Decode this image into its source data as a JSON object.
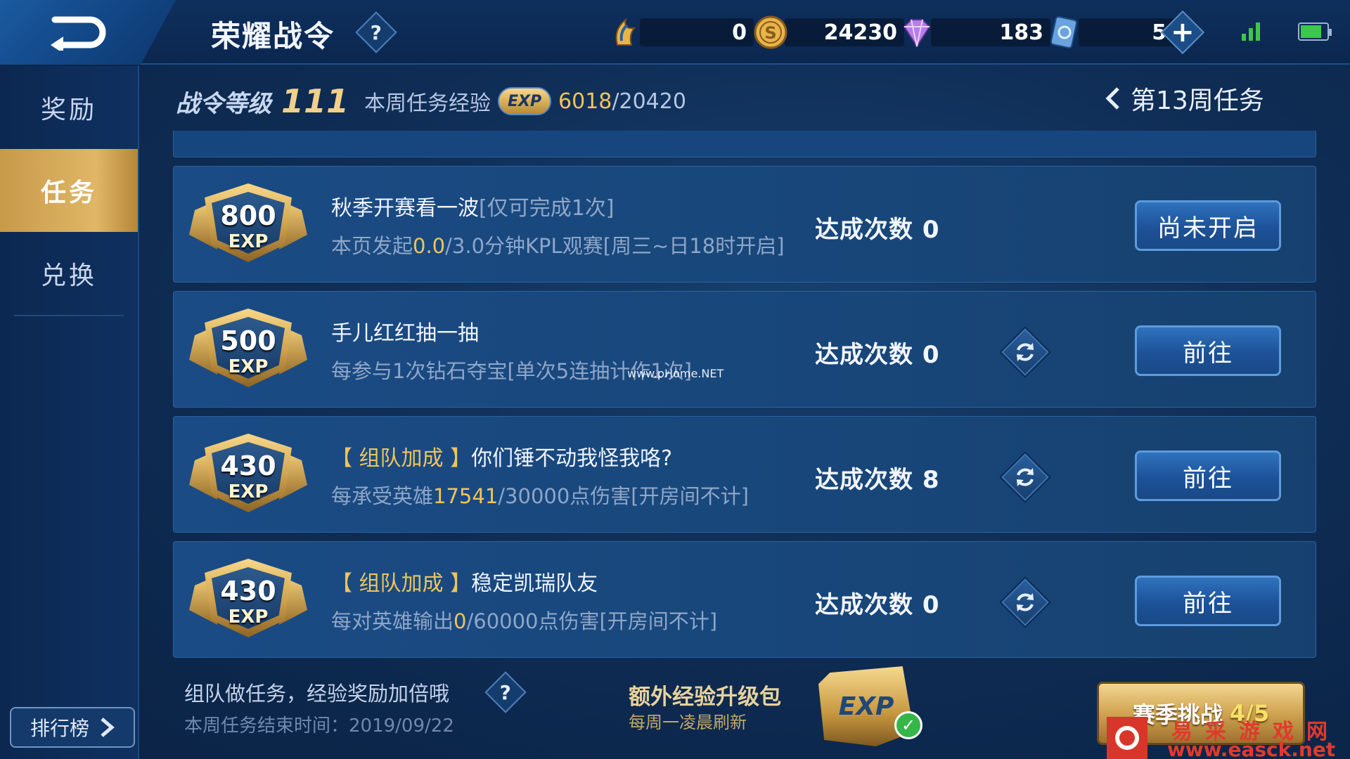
{
  "header": {
    "title": "荣耀战令",
    "help_label": "?",
    "resources": [
      {
        "name": "battle-token",
        "value": "0"
      },
      {
        "name": "gold-coin",
        "value": "24230"
      },
      {
        "name": "diamond",
        "value": "183"
      },
      {
        "name": "voucher",
        "value": "54"
      }
    ],
    "plus_label": "+",
    "battery_level": 0.8
  },
  "sidebar": {
    "items": [
      {
        "label": "奖励",
        "active": false
      },
      {
        "label": "任务",
        "active": true
      },
      {
        "label": "兑换",
        "active": false
      }
    ],
    "rank_label": "排行榜"
  },
  "level": {
    "label": "战令等级",
    "value": "111",
    "weekly_exp_label": "本周任务经验",
    "exp_badge": "EXP",
    "exp_current": "6018",
    "exp_total": "/20420"
  },
  "week_nav": {
    "label": "第13周任务"
  },
  "tasks": [
    {
      "exp": "800",
      "exp_unit": "EXP",
      "tag": "",
      "title": "秋季开赛看一波",
      "limit": "[仅可完成1次]",
      "desc_pre": "本页发起",
      "desc_hl": "0.0",
      "desc_post": "/3.0分钟KPL观赛[周三~日18时开启]",
      "count_label": "达成次数 0",
      "button": "尚未开启",
      "refresh": false
    },
    {
      "exp": "500",
      "exp_unit": "EXP",
      "tag": "",
      "title": "手儿红红抽一抽",
      "limit": "",
      "desc_pre": "每参与1次钻石夺宝[单次5连抽计作1次]",
      "desc_hl": "",
      "desc_post": "",
      "count_label": "达成次数 0",
      "button": "前往",
      "refresh": true
    },
    {
      "exp": "430",
      "exp_unit": "EXP",
      "tag": "【 组队加成 】",
      "title": "你们锤不动我怪我咯?",
      "limit": "",
      "desc_pre": "每承受英雄",
      "desc_hl": "17541",
      "desc_post": "/30000点伤害[开房间不计]",
      "count_label": "达成次数 8",
      "button": "前往",
      "refresh": true
    },
    {
      "exp": "430",
      "exp_unit": "EXP",
      "tag": "【 组队加成 】",
      "title": "稳定凯瑞队友",
      "limit": "",
      "desc_pre": "每对英雄输出",
      "desc_hl": "0",
      "desc_post": "/60000点伤害[开房间不计]",
      "count_label": "达成次数 0",
      "button": "前往",
      "refresh": true
    }
  ],
  "footer": {
    "team_note": "组队做任务，经验奖励加倍哦",
    "end_time": "本周任务结束时间：2019/09/22",
    "help_label": "?",
    "bonus_title": "额外经验升级包",
    "bonus_sub": "每周一凌晨刷新",
    "chest_label": "EXP",
    "season_label": "赛季挑战",
    "season_progress": "4/5"
  },
  "watermarks": {
    "center": "www.pHome.NET",
    "brand_cn": "易采游戏网",
    "brand_url": "www.easck.net"
  }
}
